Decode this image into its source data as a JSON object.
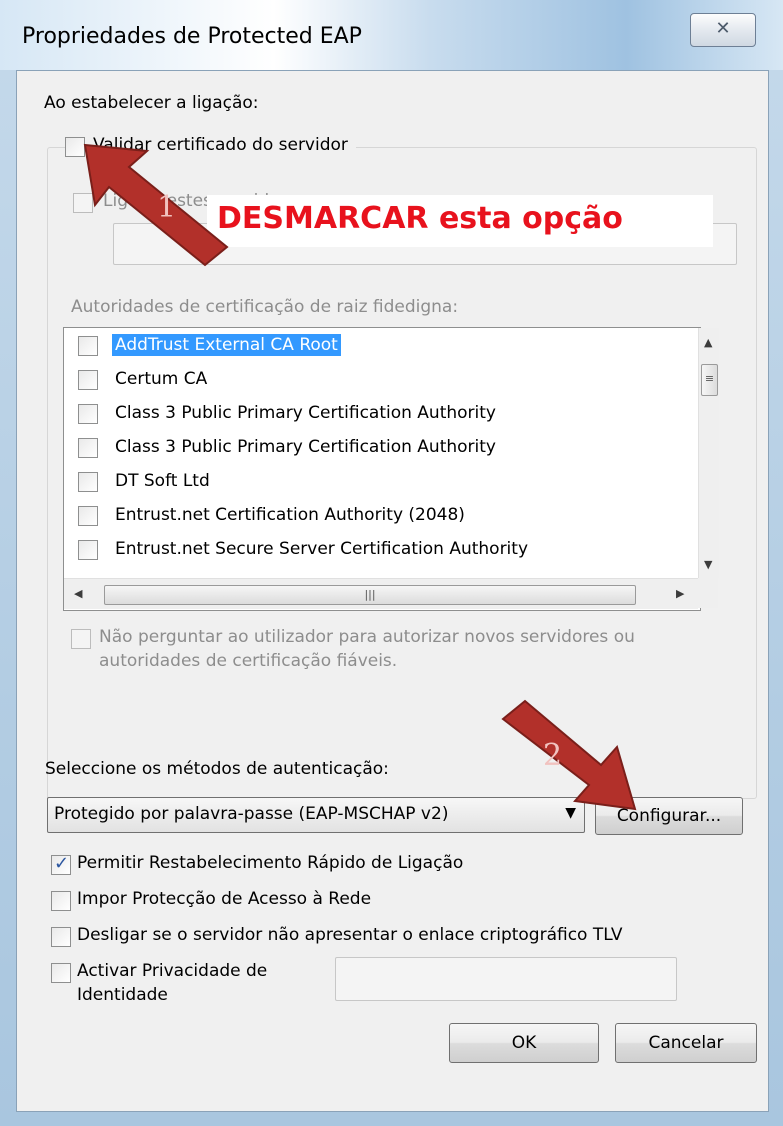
{
  "window": {
    "title": "Propriedades de Protected EAP",
    "close_glyph": "✕"
  },
  "connect_section": {
    "heading": "Ao estabelecer a ligação:",
    "validate_cert_label": "Validar certificado do servidor",
    "validate_cert_checked": false,
    "connect_servers_label": "Ligar a estes servidores:",
    "trusted_root_label": "Autoridades de certificação de raiz fidedigna:",
    "ca_list": [
      {
        "name": "AddTrust External CA Root",
        "checked": false,
        "selected": true
      },
      {
        "name": "Certum CA",
        "checked": false,
        "selected": false
      },
      {
        "name": "Class 3 Public Primary Certification Authority",
        "checked": false,
        "selected": false
      },
      {
        "name": "Class 3 Public Primary Certification Authority",
        "checked": false,
        "selected": false
      },
      {
        "name": "DT Soft Ltd",
        "checked": false,
        "selected": false
      },
      {
        "name": "Entrust.net Certification Authority (2048)",
        "checked": false,
        "selected": false
      },
      {
        "name": "Entrust.net Secure Server Certification Authority",
        "checked": false,
        "selected": false
      }
    ],
    "no_prompt_label_line1": "Não perguntar ao utilizador para autorizar novos servidores ou",
    "no_prompt_label_line2": "autoridades de certificação fiáveis."
  },
  "auth_section": {
    "heading": "Seleccione os métodos de autenticação:",
    "method_value": "Protegido por palavra-passe (EAP-MSCHAP v2)",
    "configure_button": "Configurar...",
    "options": [
      {
        "label": "Permitir Restabelecimento Rápido de Ligação",
        "checked": true
      },
      {
        "label": "Impor Protecção de Acesso à Rede",
        "checked": false
      },
      {
        "label": "Desligar se o servidor não apresentar o enlace criptográfico TLV",
        "checked": false
      }
    ],
    "identity_privacy_line1": "Activar Privacidade de",
    "identity_privacy_line2": "Identidade",
    "identity_privacy_checked": false
  },
  "buttons": {
    "ok": "OK",
    "cancel": "Cancelar"
  },
  "annotations": {
    "instruction_text": "DESMARCAR esta opção",
    "instruction_color": "#e8121d",
    "arrow_color": "#b2302a",
    "step1": "1",
    "step2": "2"
  },
  "colors": {
    "selection": "#3399ff",
    "checkmark": "#2b56a0"
  }
}
